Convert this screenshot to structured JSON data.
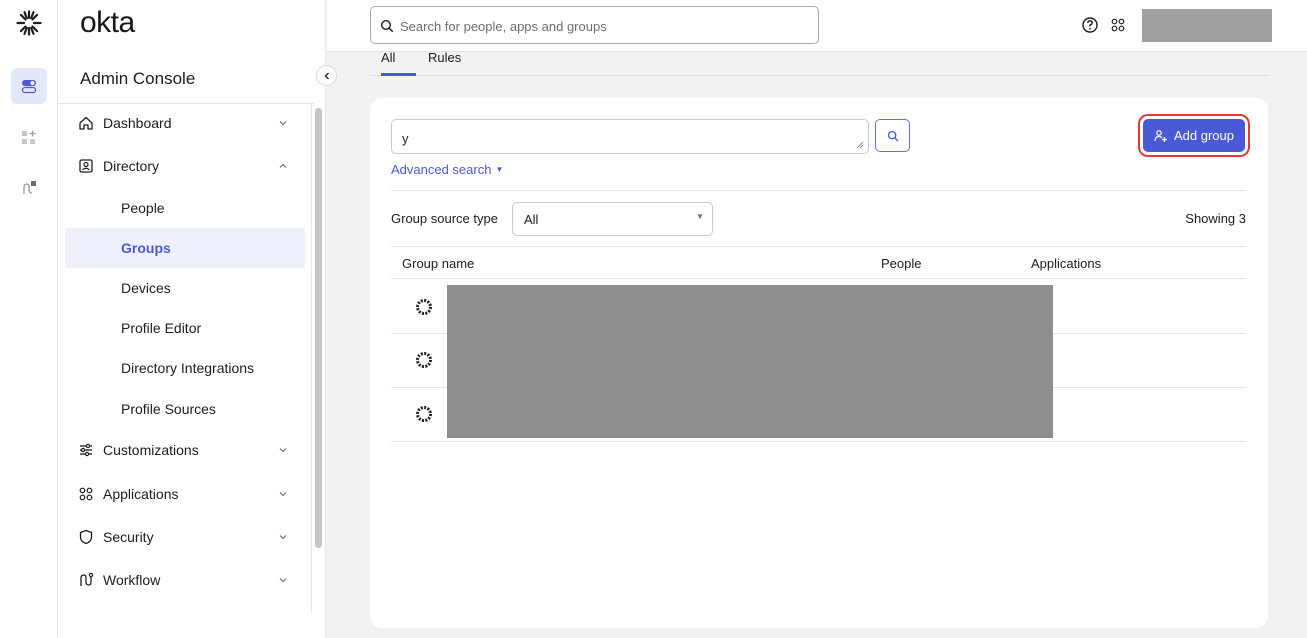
{
  "rail": {
    "items": [
      {
        "icon": "toggle-icon",
        "active": true
      },
      {
        "icon": "add-apps-icon",
        "active": false
      },
      {
        "icon": "workflow-icon",
        "active": false
      }
    ]
  },
  "sidebar": {
    "brand": "okta",
    "console_title": "Admin Console",
    "items": [
      {
        "label": "Dashboard",
        "icon": "home-icon",
        "expanded": false
      },
      {
        "label": "Directory",
        "icon": "directory-icon",
        "expanded": true
      },
      {
        "label": "Customizations",
        "icon": "sliders-icon",
        "expanded": false
      },
      {
        "label": "Applications",
        "icon": "apps-grid-icon",
        "expanded": false
      },
      {
        "label": "Security",
        "icon": "shield-icon",
        "expanded": false
      },
      {
        "label": "Workflow",
        "icon": "workflow-icon",
        "expanded": false
      }
    ],
    "directory_subitems": [
      {
        "label": "People",
        "active": false
      },
      {
        "label": "Groups",
        "active": true
      },
      {
        "label": "Devices",
        "active": false
      },
      {
        "label": "Profile Editor",
        "active": false
      },
      {
        "label": "Directory Integrations",
        "active": false
      },
      {
        "label": "Profile Sources",
        "active": false
      }
    ]
  },
  "topbar": {
    "search_placeholder": "Search for people, apps and groups"
  },
  "tabs": [
    {
      "label": "All",
      "active": true
    },
    {
      "label": "Rules",
      "active": false
    }
  ],
  "groups": {
    "filter_value": "y",
    "advanced_search_label": "Advanced search",
    "add_group_label": "Add group",
    "group_source_label": "Group source type",
    "group_source_value": "All",
    "showing_text": "Showing 3",
    "columns": [
      "Group name",
      "People",
      "Applications"
    ],
    "rows_count_shown": 3
  },
  "colors": {
    "accent": "#4a5ad6",
    "highlight_border": "#e53935",
    "redaction": "#8e8e8e"
  }
}
